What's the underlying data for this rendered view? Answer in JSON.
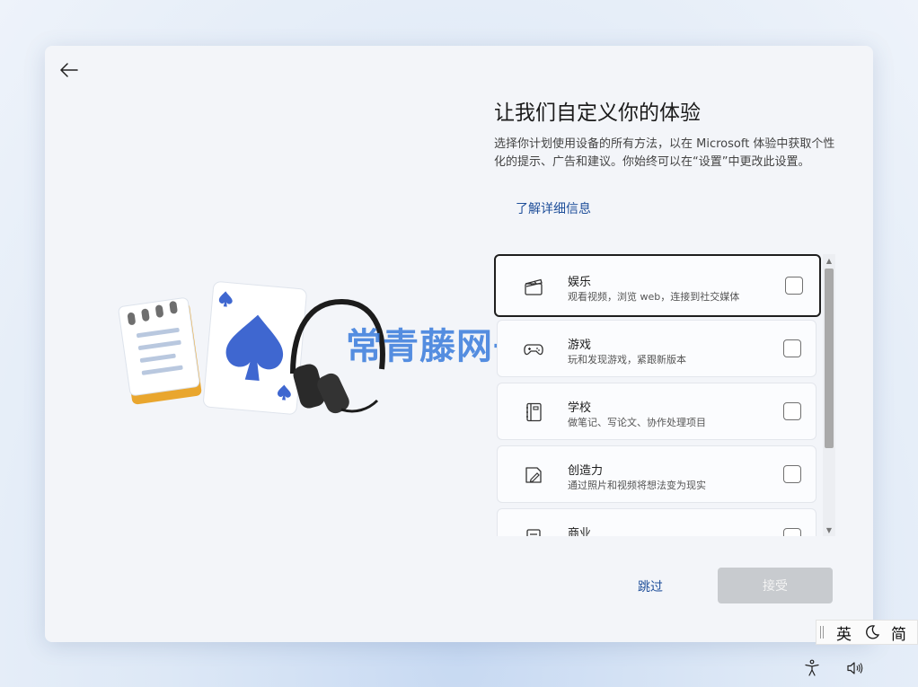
{
  "page": {
    "title": "让我们自定义你的体验",
    "description": "选择你计划使用设备的所有方法，以在 Microsoft 体验中获取个性化的提示、广告和建议。你始终可以在“设置”中更改此设置。",
    "learn_more": "了解详细信息",
    "watermark": "常青藤网子"
  },
  "options": [
    {
      "label": "娱乐",
      "sub": "观看视频，浏览 web，连接到社交媒体",
      "icon": "clapperboard-icon",
      "checked": false,
      "focused": true
    },
    {
      "label": "游戏",
      "sub": "玩和发现游戏，紧跟新版本",
      "icon": "gamepad-icon",
      "checked": false
    },
    {
      "label": "学校",
      "sub": "做笔记、写论文、协作处理项目",
      "icon": "notebook-icon",
      "checked": false
    },
    {
      "label": "创造力",
      "sub": "通过照片和视频将想法变为现实",
      "icon": "creative-pen-icon",
      "checked": false
    },
    {
      "label": "商业",
      "sub": "",
      "icon": "document-icon",
      "checked": false
    }
  ],
  "footer": {
    "skip": "跳过",
    "accept": "接受"
  },
  "ime": {
    "lang": "英",
    "mode": "简"
  },
  "colors": {
    "accent": "#1f4f9a",
    "spade": "#3f67d0",
    "disabled_button": "#c8cbcf"
  }
}
